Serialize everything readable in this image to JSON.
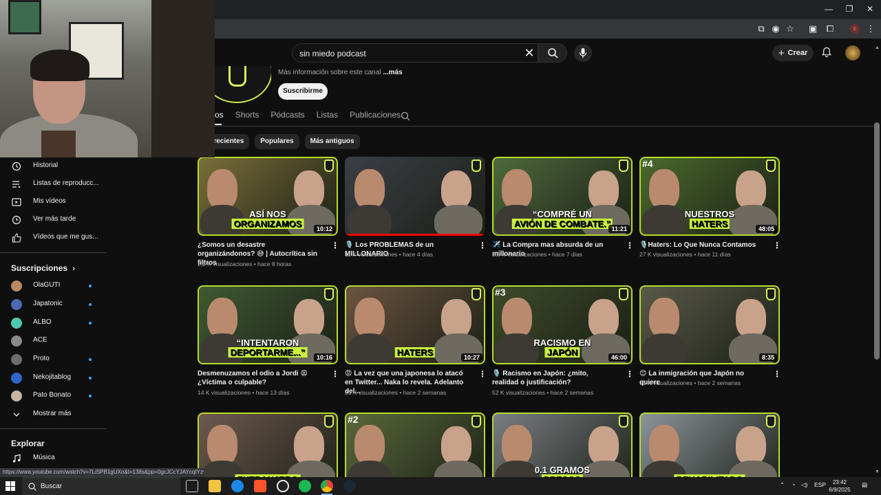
{
  "browser": {
    "window_controls": [
      "—",
      "❐",
      "✕"
    ]
  },
  "header": {
    "search_value": "sin miedo podcast",
    "create_label": "Crear"
  },
  "channel": {
    "more_info_prefix": "Más información sobre este canal",
    "more_info_link": "...más",
    "subscribe_label": "Suscribirme"
  },
  "tabs": [
    {
      "label": "os",
      "active": true
    },
    {
      "label": "Shorts"
    },
    {
      "label": "Pódcasts"
    },
    {
      "label": "Listas"
    },
    {
      "label": "Publicaciones"
    }
  ],
  "chips": [
    "s recientes",
    "Populares",
    "Más antiguos"
  ],
  "sidebar": {
    "items": [
      {
        "label": "Historial",
        "icon": "history-icon"
      },
      {
        "label": "Listas de reproducc...",
        "icon": "playlists-icon"
      },
      {
        "label": "Mis vídeos",
        "icon": "my-videos-icon"
      },
      {
        "label": "Ver más tarde",
        "icon": "watch-later-icon"
      },
      {
        "label": "Vídeos que me gus...",
        "icon": "thumbs-up-icon"
      }
    ],
    "subscriptions_heading": "Suscripciones",
    "subscriptions": [
      {
        "label": "OlaGUTI",
        "dot": true,
        "color": "#b88a63"
      },
      {
        "label": "Japatonic",
        "dot": true,
        "color": "#4a6ab0"
      },
      {
        "label": "ALBO",
        "dot": true,
        "color": "#4ec9b0"
      },
      {
        "label": "ACE",
        "dot": false,
        "color": "#8a8a8a"
      },
      {
        "label": "Proto",
        "dot": true,
        "color": "#6d6d6d"
      },
      {
        "label": "Nekojitablog",
        "dot": true,
        "color": "#2f66c9"
      },
      {
        "label": "Pato Bonato",
        "dot": true,
        "color": "#c7b5a3"
      }
    ],
    "show_more": "Mostrar más",
    "explore_heading": "Explorar",
    "explore_items": [
      {
        "label": "Música",
        "icon": "music-icon"
      }
    ]
  },
  "videos": [
    {
      "title": "¿Somos un desastre organizándonos? 😅 | Autocrítica sin filtros",
      "views": "2,2 K visualizaciones",
      "age": "hace 8 horas",
      "duration": "10:12",
      "caption1": "ASÍ NOS",
      "caption2": "ORGANIZAMOS",
      "rank": "",
      "bg": "#7a6f3a"
    },
    {
      "title": "🎙️ Los PROBLEMAS de un MILLONARIO",
      "views": "11 K visualizaciones",
      "age": "hace 4 días",
      "duration": "",
      "caption1": "",
      "caption2": "",
      "rank": "",
      "bg": "#3b3f46",
      "watched": true
    },
    {
      "title": "✈️ La Compra mas absurda de un millonario",
      "views": "5,3 K visualizaciones",
      "age": "hace 7 días",
      "duration": "11:21",
      "caption1": "“COMPRÉ UN",
      "caption2": "AVIÓN DE COMBATE.”",
      "rank": "",
      "bg": "#4f6a3c"
    },
    {
      "title": "🎙️Haters: Lo Que Nunca Contamos",
      "views": "27 K visualizaciones",
      "age": "hace 11 días",
      "duration": "48:05",
      "caption1": "NUESTROS",
      "caption2": "HATERS",
      "rank": "#4",
      "bg": "#4b6a2c"
    },
    {
      "title": "Desmenuzamos el odio a Jordi 😩 ¿Víctima o culpable?",
      "views": "14 K visualizaciones",
      "age": "hace 13 días",
      "duration": "10:16",
      "caption1": "“INTENTARON",
      "caption2": "DEPORTARME...”",
      "rank": "",
      "bg": "#3f5a32"
    },
    {
      "title": "😡 La vez que una japonesa lo atacó en Twitter... Naka lo revela. Adelanto del...",
      "views": "31 K visualizaciones",
      "age": "hace 2 semanas",
      "duration": "10:27",
      "caption1": "",
      "caption2": "HATERS",
      "rank": "",
      "bg": "#6b5540"
    },
    {
      "title": "🎙️ Racismo en Japón: ¿mito, realidad o justificación?",
      "views": "52 K visualizaciones",
      "age": "hace 2 semanas",
      "duration": "46:00",
      "caption1": "RACISMO EN",
      "caption2": "JAPÓN",
      "rank": "#3",
      "bg": "#3d4a29"
    },
    {
      "title": "😊 La inmigración que Japón no quiere",
      "views": "13 K visualizaciones",
      "age": "hace 2 semanas",
      "duration": "8:35",
      "caption1": "",
      "caption2": "",
      "rank": "",
      "bg": "#5a5a4a"
    },
    {
      "title": "",
      "views": "",
      "age": "",
      "duration": "",
      "caption1": "",
      "caption2": "EXTRANJERO",
      "rank": "",
      "bg": "#6f5a50"
    },
    {
      "title": "",
      "views": "",
      "age": "",
      "duration": "",
      "caption1": "",
      "caption2": "",
      "rank": "#2",
      "bg": "#5a6a3a"
    },
    {
      "title": "",
      "views": "",
      "age": "",
      "duration": "",
      "caption1": "0.1 GRAMOS",
      "caption2": "PRESOS",
      "rank": "",
      "bg": "#7b7f84"
    },
    {
      "title": "",
      "views": "",
      "age": "",
      "duration": "",
      "caption1": "",
      "caption2": "REHABILITADO",
      "rank": "",
      "bg": "#8d969c"
    }
  ],
  "status_url": "https://www.youtube.com/watch?v=7LiSPB1gUXo&t=138s&pp=0gcJCcYJAYcqIYzv",
  "taskbar": {
    "search_label": "Buscar",
    "language": "ESP",
    "time": "23:42",
    "date": "6/9/2025"
  }
}
